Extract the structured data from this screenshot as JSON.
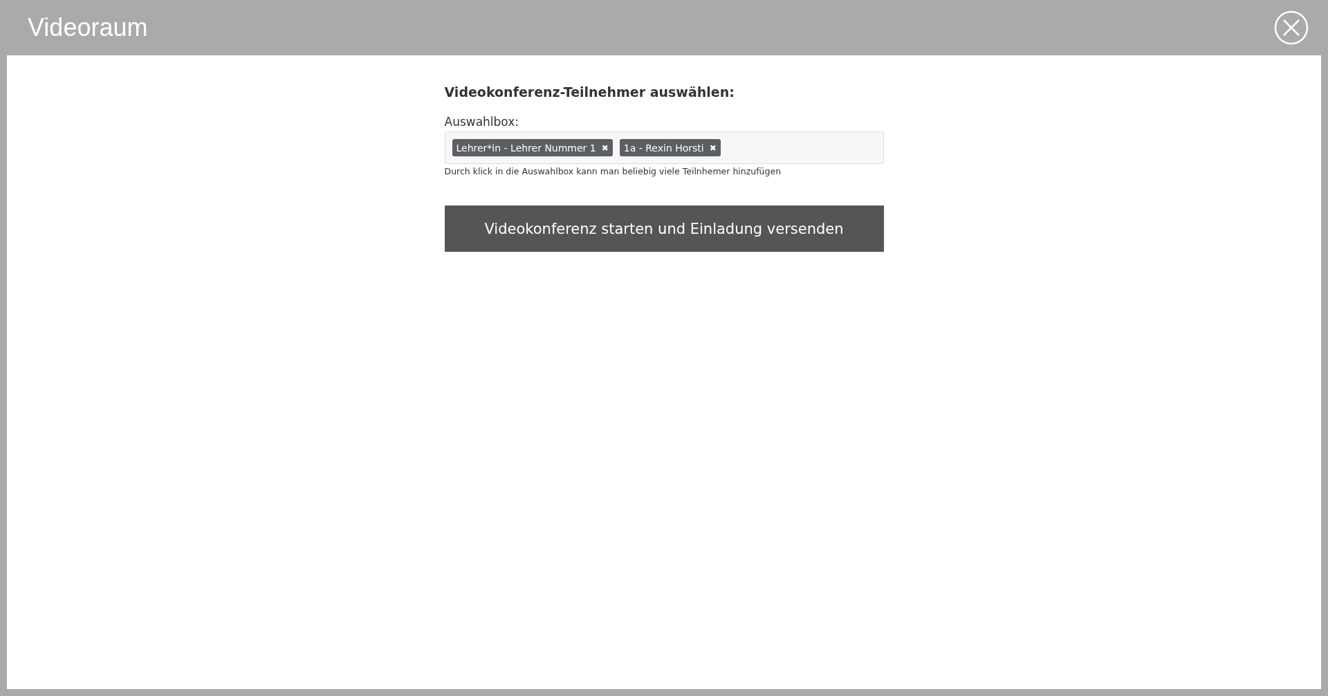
{
  "window": {
    "title": "Videoraum"
  },
  "form": {
    "heading": "Videokonferenz-Teilnehmer auswählen:",
    "field_label": "Auswahlbox:",
    "chips": [
      {
        "label": "Lehrer*in - Lehrer Nummer 1",
        "remove": "✖"
      },
      {
        "label": "1a - Rexin Horsti",
        "remove": "✖"
      }
    ],
    "help": "Durch klick in die Auswahlbox kann man beliebig viele Teilnhemer hinzufügen",
    "submit": "Videokonferenz starten und Einladung versenden"
  }
}
